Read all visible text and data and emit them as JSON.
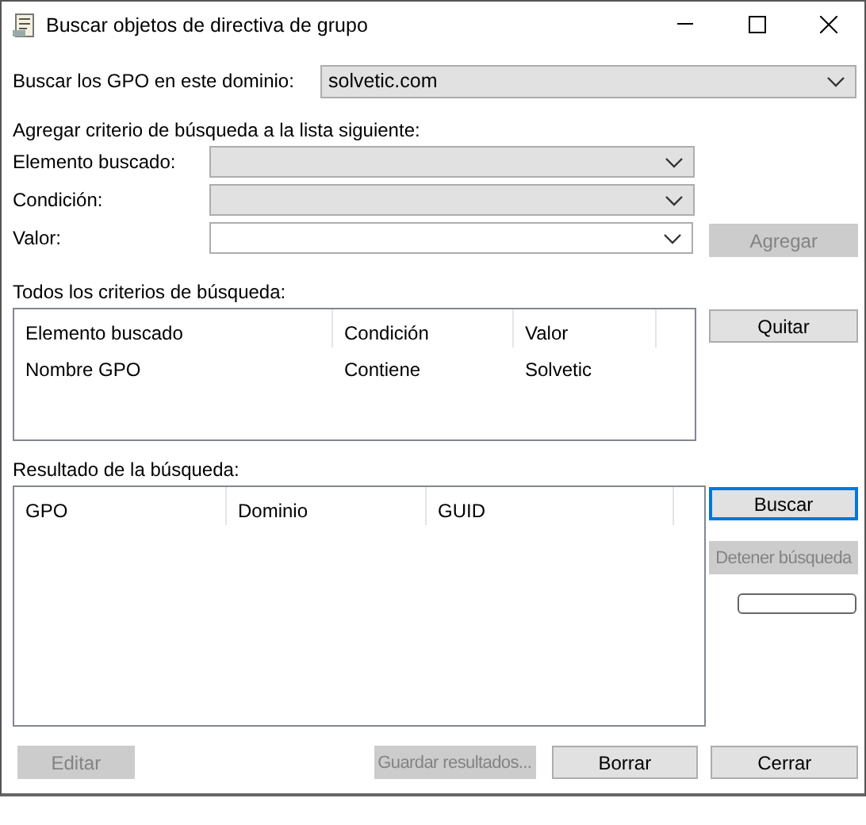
{
  "window": {
    "title": "Buscar objetos de directiva de grupo"
  },
  "domain": {
    "label": "Buscar los GPO en este dominio:",
    "value": "solvetic.com"
  },
  "criteria_form": {
    "heading": "Agregar criterio de búsqueda a la lista siguiente:",
    "fields": [
      {
        "label": "Elemento buscado:",
        "disabled": true
      },
      {
        "label": "Condición:",
        "disabled": true
      },
      {
        "label": "Valor:",
        "disabled": false
      }
    ],
    "add_button": {
      "label": "Agregar",
      "disabled": true
    }
  },
  "criteria_list": {
    "heading": "Todos los criterios de búsqueda:",
    "columns": [
      "Elemento buscado",
      "Condición",
      "Valor"
    ],
    "rows": [
      [
        "Nombre GPO",
        "Contiene",
        "Solvetic"
      ]
    ],
    "remove_button": {
      "label": "Quitar",
      "disabled": false
    }
  },
  "results": {
    "heading": "Resultado de la búsqueda:",
    "columns": [
      "GPO",
      "Dominio",
      "GUID"
    ],
    "search_button": {
      "label": "Buscar",
      "disabled": false,
      "focused": true
    },
    "stop_button": {
      "label": "Detener búsqueda",
      "disabled": true
    }
  },
  "footer_buttons": [
    {
      "label": "Editar",
      "disabled": true
    },
    {
      "label": "Guardar resultados...",
      "disabled": true
    },
    {
      "label": "Borrar",
      "disabled": false
    },
    {
      "label": "Cerrar",
      "disabled": false
    }
  ]
}
